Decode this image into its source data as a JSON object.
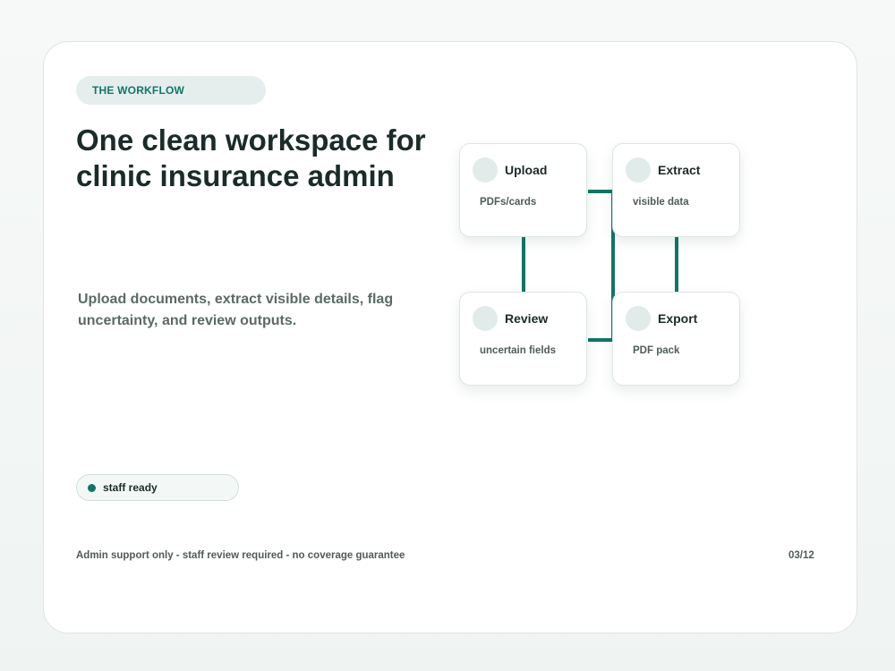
{
  "slide": {
    "eyebrow": "THE WORKFLOW",
    "title": "One clean workspace for clinic insurance admin",
    "subtitle": "Upload documents, extract visible details, flag uncertainty, and review outputs.",
    "status": {
      "label": "staff ready",
      "color": "#137567"
    },
    "footer_note": "Admin support only - staff review required - no coverage guarantee",
    "page_number": "03/12"
  },
  "workflow": {
    "connector_color": "#137567",
    "steps": [
      {
        "title": "Upload",
        "description": "PDFs/cards",
        "icon": "circle-placeholder-icon"
      },
      {
        "title": "Extract",
        "description": "visible data",
        "icon": "circle-placeholder-icon"
      },
      {
        "title": "Review",
        "description": "uncertain fields",
        "icon": "circle-placeholder-icon"
      },
      {
        "title": "Export",
        "description": "PDF pack",
        "icon": "circle-placeholder-icon"
      }
    ]
  }
}
